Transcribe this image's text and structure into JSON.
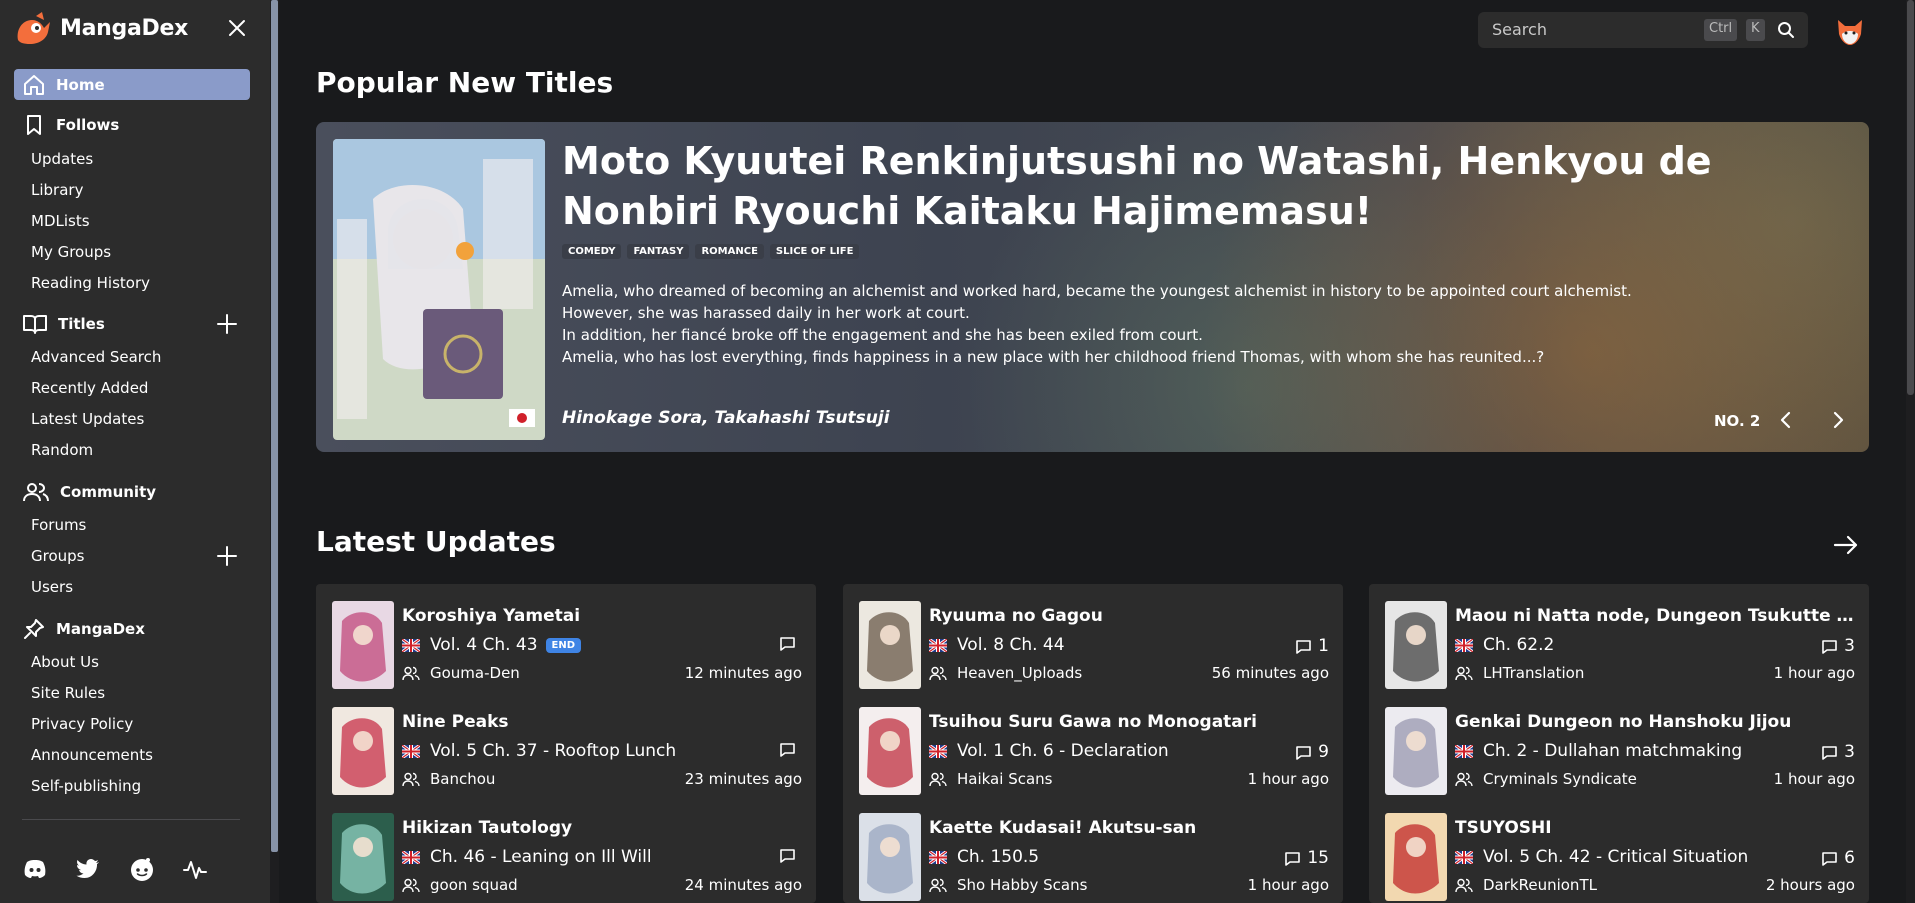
{
  "app": {
    "name": "MangaDex"
  },
  "sidebar": {
    "home": "Home",
    "follows": {
      "label": "Follows",
      "items": [
        "Updates",
        "Library",
        "MDLists",
        "My Groups",
        "Reading History"
      ]
    },
    "titles": {
      "label": "Titles",
      "items": [
        "Advanced Search",
        "Recently Added",
        "Latest Updates",
        "Random"
      ]
    },
    "community": {
      "label": "Community",
      "items": [
        "Forums",
        "Groups",
        "Users"
      ]
    },
    "mangadex": {
      "label": "MangaDex",
      "items": [
        "About Us",
        "Site Rules",
        "Privacy Policy",
        "Announcements",
        "Self-publishing"
      ]
    },
    "socials": [
      "discord-icon",
      "twitter-icon",
      "reddit-icon",
      "status-icon"
    ]
  },
  "search": {
    "placeholder": "Search",
    "kbd1": "Ctrl",
    "kbd2": "K"
  },
  "popular": {
    "section_title": "Popular New Titles",
    "title": "Moto Kyuutei Renkinjutsushi no Watashi, Henkyou de Nonbiri Ryouchi Kaitaku Hajimemasu!",
    "tags": [
      "COMEDY",
      "FANTASY",
      "ROMANCE",
      "SLICE OF LIFE"
    ],
    "description": [
      "Amelia, who dreamed of becoming an alchemist and worked hard, became the youngest alchemist in history to be appointed court alchemist.",
      "However, she was harassed daily in her work at court.",
      "In addition, her fiancé broke off the engagement and she has been exiled from court.",
      "Amelia, who has lost everything, finds happiness in a new place with her childhood friend Thomas, with whom she has reunited...?"
    ],
    "authors": "Hinokage Sora, Takahashi Tsutsuji",
    "rank": "NO. 2"
  },
  "latest": {
    "section_title": "Latest Updates",
    "columns": [
      [
        {
          "title": "Koroshiya Yametai",
          "chapter": "Vol. 4 Ch. 43",
          "badge": "END",
          "comments": "",
          "group": "Gouma-Den",
          "time": "12 minutes ago"
        },
        {
          "title": "Nine Peaks",
          "chapter": "Vol. 5 Ch. 37 - Rooftop Lunch",
          "comments": "",
          "group": "Banchou",
          "time": "23 minutes ago"
        },
        {
          "title": "Hikizan Tautology",
          "chapter": "Ch. 46 - Leaning on Ill Will",
          "comments": "",
          "group": "goon squad",
          "time": "24 minutes ago"
        }
      ],
      [
        {
          "title": "Ryuuma no Gagou",
          "chapter": "Vol. 8 Ch. 44",
          "comments": "1",
          "group": "Heaven_Uploads",
          "time": "56 minutes ago"
        },
        {
          "title": "Tsuihou Suru Gawa no Monogatari",
          "chapter": "Vol. 1 Ch. 6 - Declaration",
          "comments": "9",
          "group": "Haikai Scans",
          "time": "1 hour ago"
        },
        {
          "title": "Kaette Kudasai! Akutsu-san",
          "chapter": "Ch. 150.5",
          "comments": "15",
          "group": "Sho Habby Scans",
          "time": "1 hour ago"
        }
      ],
      [
        {
          "title": "Maou ni Natta node, Dungeon Tsukutte Jingai Musume to Honobono Suru",
          "chapter": "Ch. 62.2",
          "comments": "3",
          "group": "LHTranslation",
          "time": "1 hour ago"
        },
        {
          "title": "Genkai Dungeon no Hanshoku Jijou",
          "chapter": "Ch. 2 - Dullahan matchmaking",
          "comments": "3",
          "group": "Cryminals Syndicate",
          "time": "1 hour ago"
        },
        {
          "title": "TSUYOSHI",
          "chapter": "Vol. 5 Ch. 42 - Critical Situation",
          "comments": "6",
          "group": "DarkReunionTL",
          "time": "2 hours ago"
        }
      ]
    ]
  }
}
